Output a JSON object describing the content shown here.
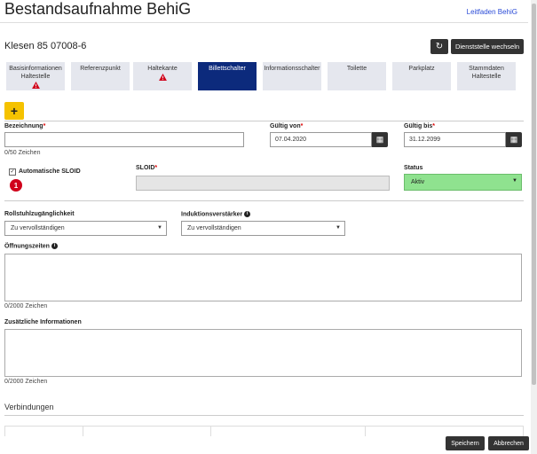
{
  "header": {
    "title": "Bestandsaufnahme BehiG",
    "help_link": "Leitfaden BehiG"
  },
  "location": {
    "name": "Klesen 85 07008-6",
    "change_button": "Dienststelle wechseln"
  },
  "tabs": [
    {
      "label": "Basisinformationen Haltestelle",
      "warning": true,
      "active": false
    },
    {
      "label": "Referenzpunkt",
      "warning": false,
      "active": false
    },
    {
      "label": "Haltekante",
      "warning": true,
      "active": false
    },
    {
      "label": "Billettschalter",
      "warning": false,
      "active": true
    },
    {
      "label": "Informationsschalter",
      "warning": false,
      "active": false
    },
    {
      "label": "Toilette",
      "warning": false,
      "active": false
    },
    {
      "label": "Parkplatz",
      "warning": false,
      "active": false
    },
    {
      "label": "Stammdaten Haltestelle",
      "warning": false,
      "active": false
    }
  ],
  "add_button": "+",
  "form": {
    "bezeichnung_label": "Bezeichnung",
    "bezeichnung_value": "",
    "bezeichnung_hint": "0/50 Zeichen",
    "gueltig_von_label": "Gültig von",
    "gueltig_von_value": "07.04.2020",
    "gueltig_bis_label": "Gültig bis",
    "gueltig_bis_value": "31.12.2099",
    "auto_sloid_label": "Automatische SLOID",
    "auto_sloid_checked": true,
    "badge": "1",
    "sloid_label": "SLOID",
    "sloid_value": "",
    "status_label": "Status",
    "status_value": "Aktiv",
    "rollstuhl_label": "Rollstuhlzugänglichkeit",
    "rollstuhl_value": "Zu vervollständigen",
    "induktion_label": "Induktionsverstärker",
    "induktion_value": "Zu vervollständigen",
    "oeffnungszeiten_label": "Öffnungszeiten",
    "oeffnungszeiten_hint": "0/2000 Zeichen",
    "zusatz_label": "Zusätzliche Informationen",
    "zusatz_hint": "0/2000 Zeichen"
  },
  "verbindungen_title": "Verbindungen",
  "footer": {
    "save": "Speichern",
    "cancel": "Abbrechen"
  },
  "colors": {
    "active_tab": "#0c2a7c",
    "status_active": "#8fe28f",
    "add_button": "#f5c200",
    "warning": "#d0021b"
  }
}
